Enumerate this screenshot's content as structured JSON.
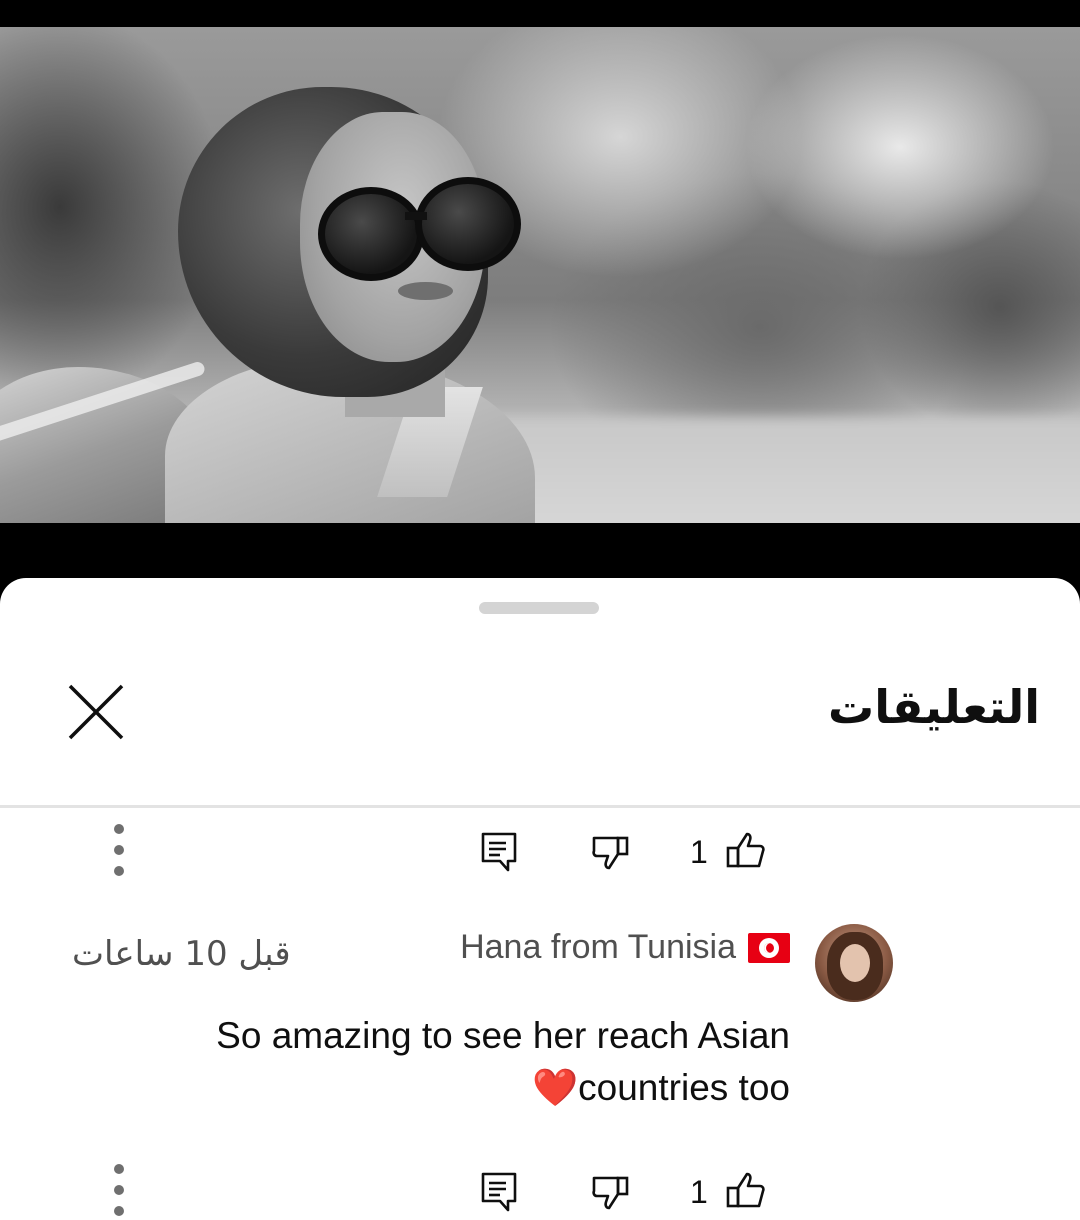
{
  "sheet": {
    "title": "التعليقات"
  },
  "comments": [
    {
      "like_count": "1"
    },
    {
      "author": "Hana from Tunisia",
      "time": "قبل 10 ساعات",
      "text_line1": "So amazing to see her reach Asian",
      "text_line2_emoji": "❤️",
      "text_line2": "countries too",
      "like_count": "1"
    }
  ],
  "icons": {
    "close": "close-icon",
    "menu": "more-vert-icon",
    "reply": "reply-icon",
    "dislike": "thumb-down-icon",
    "like": "thumb-up-icon",
    "flag": "tunisia-flag-icon"
  }
}
